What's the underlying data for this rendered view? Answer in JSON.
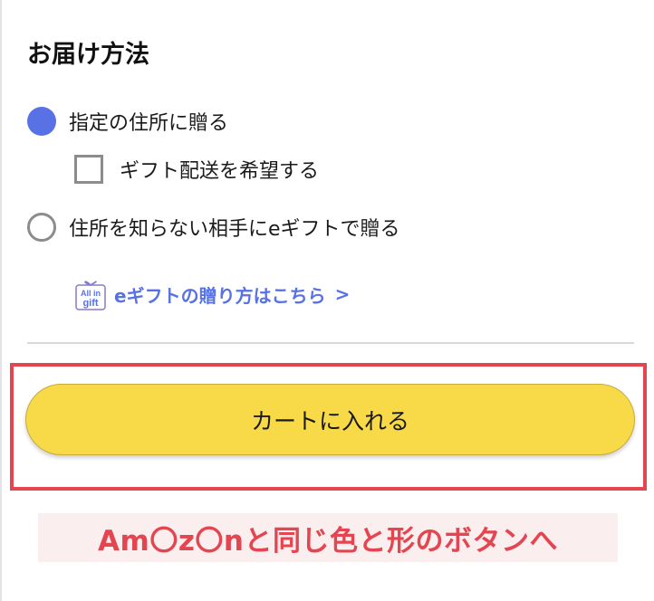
{
  "delivery": {
    "title": "お届け方法",
    "options": [
      {
        "label": "指定の住所に贈る",
        "selected": true
      },
      {
        "label": "住所を知らない相手にeギフトで贈る",
        "selected": false
      }
    ],
    "gift_shipping": {
      "label": "ギフト配送を希望する",
      "checked": false
    },
    "egift_link": {
      "label": "eギフトの贈り方はこちら",
      "icon_top": "All in",
      "icon_bottom": "gift"
    }
  },
  "cart_button": {
    "label": "カートに入れる"
  },
  "annotation": {
    "text": "Am〇z〇nと同じ色と形のボタンへ"
  },
  "colors": {
    "accent": "#5872e6",
    "button": "#f8d948",
    "highlight": "#e44651",
    "caption_bg": "#fbeeee"
  }
}
